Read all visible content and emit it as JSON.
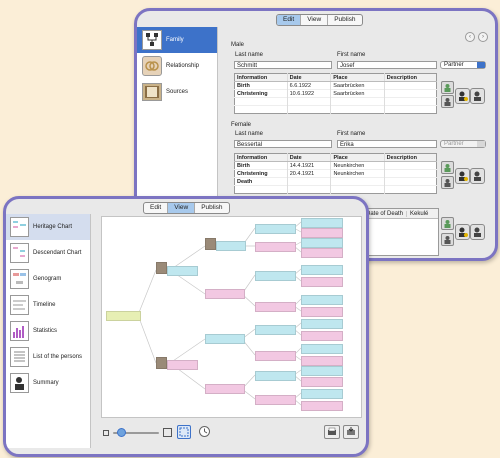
{
  "back_window": {
    "toolbar": {
      "edit": "Edit",
      "view": "View",
      "publish": "Publish",
      "active": "Edit"
    },
    "sidebar": [
      {
        "label": "Family",
        "icon": "family-icon"
      },
      {
        "label": "Relationship",
        "icon": "rings-icon"
      },
      {
        "label": "Sources",
        "icon": "book-icon"
      }
    ],
    "male": {
      "section": "Male",
      "last_name_label": "Last name",
      "first_name_label": "First name",
      "last_name": "Schmitt",
      "first_name": "Josef",
      "partner": "Partner",
      "columns": [
        "Information",
        "Date",
        "Place",
        "Description"
      ],
      "rows": [
        {
          "type": "Birth",
          "date": "6.6.1922",
          "place": "Saarbrücken"
        },
        {
          "type": "Christening",
          "date": "10.6.1922",
          "place": "Saarbrücken"
        }
      ]
    },
    "female": {
      "section": "Female",
      "last_name_label": "Last name",
      "first_name_label": "First name",
      "last_name": "Bessertal",
      "first_name": "Erika",
      "partner": "Partner",
      "columns": [
        "Information",
        "Date",
        "Place",
        "Description"
      ],
      "rows": [
        {
          "type": "Birth",
          "date": "14.4.1921",
          "place": "Neunkirchen"
        },
        {
          "type": "Christening",
          "date": "20.4.1921",
          "place": "Neunkirchen"
        },
        {
          "type": "Death",
          "date": "",
          "place": ""
        }
      ]
    },
    "children": {
      "date_of_death": "Date of Death",
      "kekule": "Kekulé"
    }
  },
  "front_window": {
    "toolbar": {
      "edit": "Edit",
      "view": "View",
      "publish": "Publish",
      "active": "View"
    },
    "sidebar": [
      {
        "label": "Heritage Chart",
        "icon": "heritage-chart-icon"
      },
      {
        "label": "Descendant Chart",
        "icon": "descendant-chart-icon"
      },
      {
        "label": "Genogram",
        "icon": "genogram-icon"
      },
      {
        "label": "Timeline",
        "icon": "timeline-icon"
      },
      {
        "label": "Statistics",
        "icon": "statistics-icon"
      },
      {
        "label": "List of the persons",
        "icon": "list-icon"
      },
      {
        "label": "Summary",
        "icon": "summary-icon"
      }
    ]
  },
  "colors": {
    "frame": "#7c74c2",
    "selection": "#3d72c9",
    "male": "#bfe7ef",
    "female": "#f2c8e2",
    "root": "#e7efb4"
  }
}
